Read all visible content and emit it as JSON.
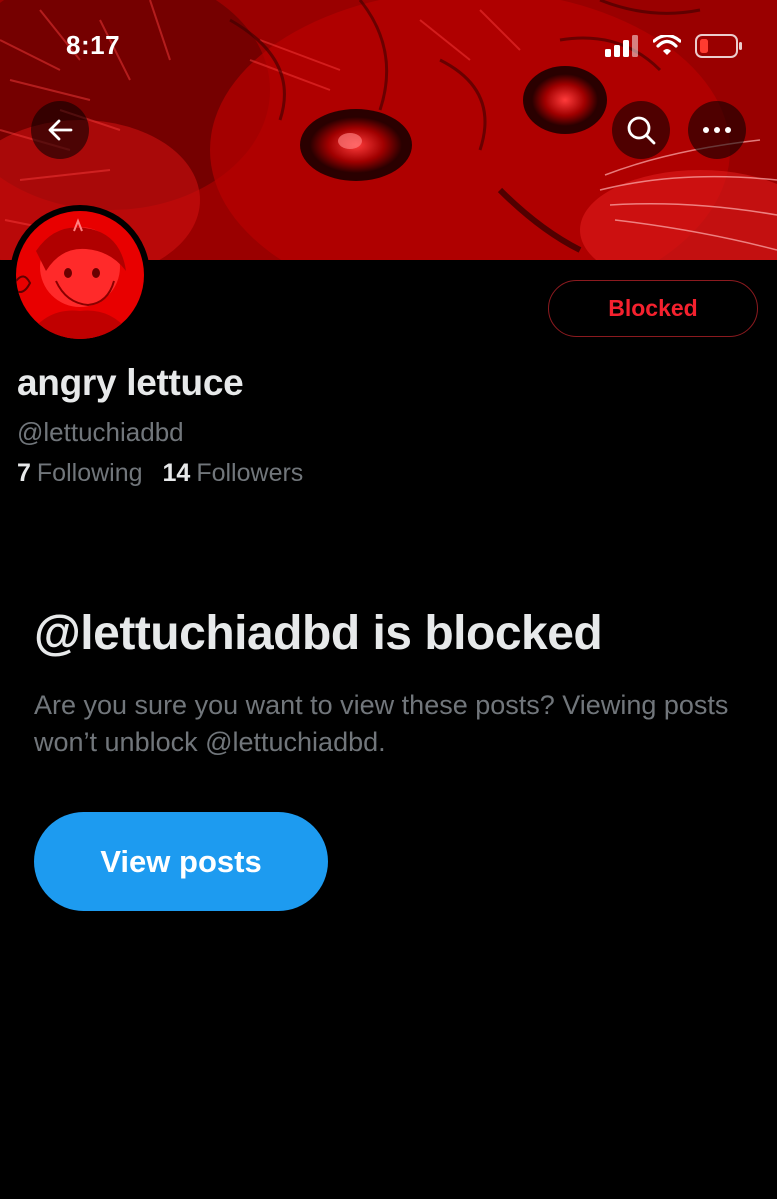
{
  "status_bar": {
    "time": "8:17"
  },
  "header": {
    "icons": [
      "back-arrow-icon",
      "search-icon",
      "more-icon"
    ]
  },
  "profile": {
    "blocked_label": "Blocked",
    "display_name": "angry lettuce",
    "handle": "@lettuchiadbd",
    "following_count": "7",
    "following_label": "Following",
    "followers_count": "14",
    "followers_label": "Followers"
  },
  "blocked_notice": {
    "title": "@lettuchiadbd is blocked",
    "description": "Are you sure you want to view these posts? Viewing posts won’t unblock @lettuchiadbd.",
    "button_label": "View posts"
  },
  "colors": {
    "background": "#000000",
    "accent_blue": "#1d9bf0",
    "blocked_red": "#f4212e",
    "secondary_text": "#71767b",
    "primary_text": "#e7e9ea",
    "banner_tint": "#c40000"
  }
}
